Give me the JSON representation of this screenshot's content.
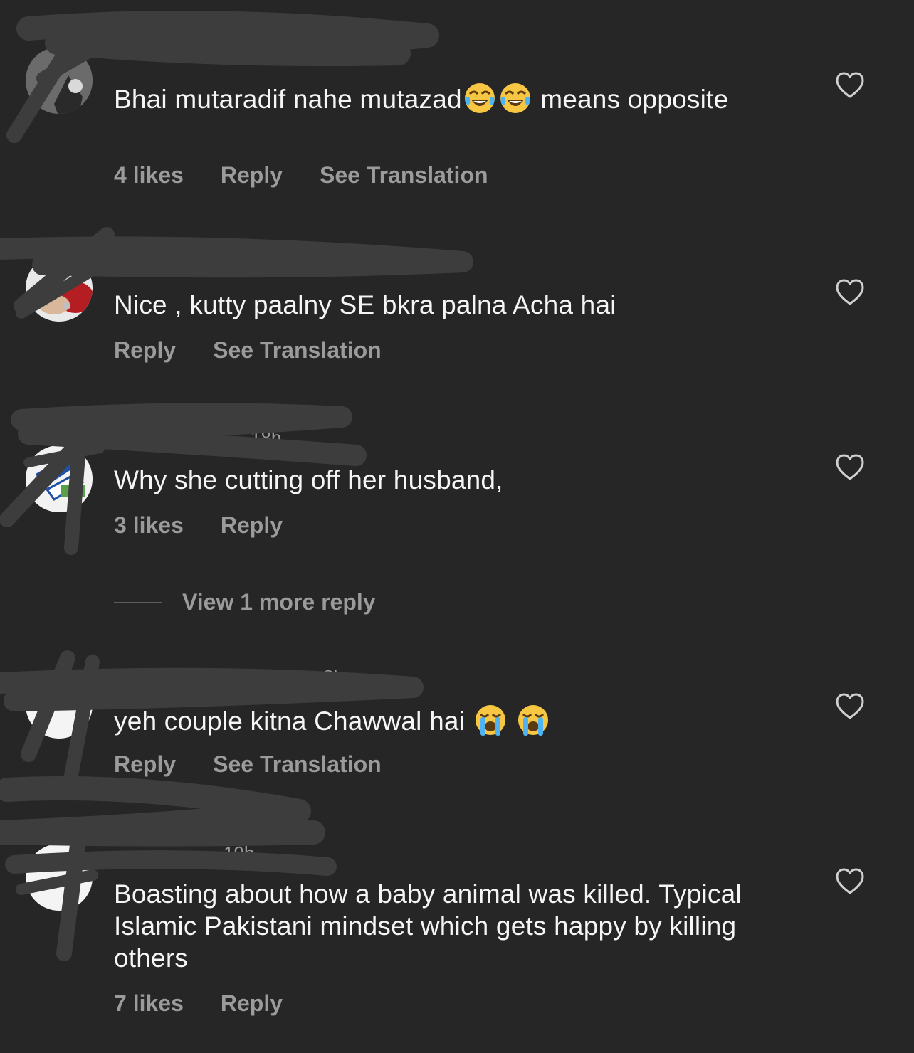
{
  "theme": {
    "background": "#262626",
    "text_primary": "#f5f5f5",
    "text_secondary": "#9b9b9b"
  },
  "comments": [
    {
      "username": "",
      "time": "",
      "text_parts": [
        "Bhai mutaradif nahe mutazad",
        "means opposite"
      ],
      "emojis": [
        "face-with-tears-of-joy",
        "face-with-tears-of-joy"
      ],
      "likes": "4 likes",
      "reply": "Reply",
      "translation": "See Translation",
      "like_icon": "heart-outline-icon"
    },
    {
      "username": "",
      "time": "",
      "text": "Nice , kutty paalny SE bkra palna Acha hai",
      "reply": "Reply",
      "translation": "See Translation",
      "like_icon": "heart-outline-icon"
    },
    {
      "username": "",
      "time": "18h",
      "text": "Why she cutting off her husband,",
      "likes": "3 likes",
      "reply": "Reply",
      "like_icon": "heart-outline-icon"
    },
    {
      "username": "",
      "time": "8h",
      "text": "yeh couple kitna Chawwal hai",
      "emojis": [
        "loudly-crying-face",
        "loudly-crying-face"
      ],
      "reply": "Reply",
      "translation": "See Translation",
      "like_icon": "heart-outline-icon"
    },
    {
      "username": "",
      "time": "19h",
      "text": "Boasting about how a baby animal was killed. Typical Islamic Pakistani mindset which gets happy by killing others",
      "likes": "7 likes",
      "reply": "Reply",
      "like_icon": "heart-outline-icon"
    }
  ],
  "view_more_replies": "View 1 more reply"
}
